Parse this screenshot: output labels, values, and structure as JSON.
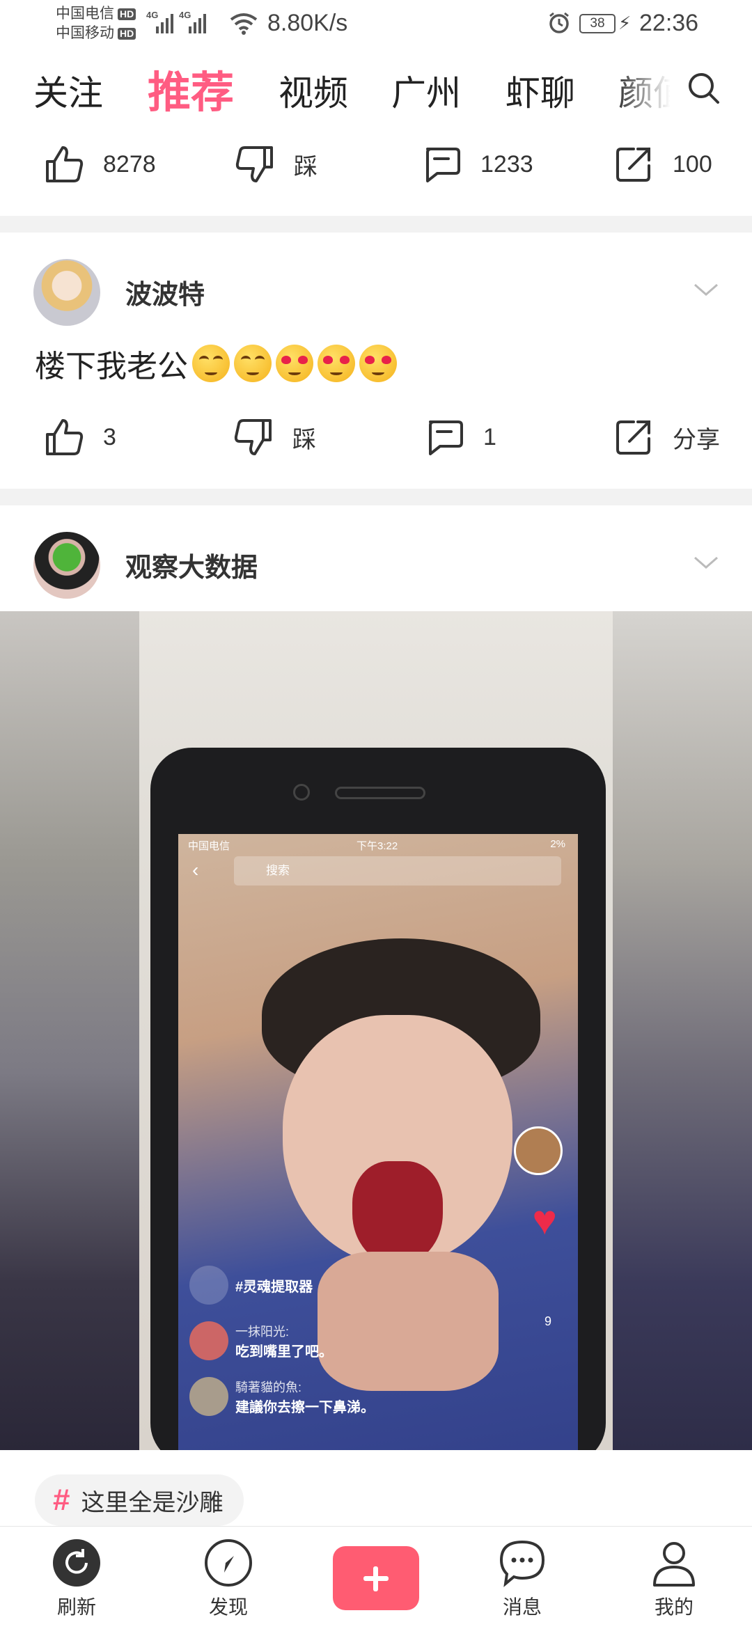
{
  "status_bar": {
    "carrier_1": "中国电信",
    "carrier_2": "中国移动",
    "hd_badge": "HD",
    "network_1": "4G",
    "network_2": "4G",
    "speed": "8.80K/s",
    "battery": "38",
    "time": "22:36"
  },
  "tabs": [
    {
      "label": "关注",
      "active": false
    },
    {
      "label": "推荐",
      "active": true
    },
    {
      "label": "视频",
      "active": false
    },
    {
      "label": "广州",
      "active": false
    },
    {
      "label": "虾聊",
      "active": false
    },
    {
      "label": "颜值",
      "active": false
    }
  ],
  "prev_post": {
    "likes": "8278",
    "dislike_label": "踩",
    "comments": "1233",
    "shares": "100"
  },
  "comment_post": {
    "username": "波波特",
    "text": "楼下我老公",
    "emojis": [
      "smug-face",
      "smug-face",
      "heart-eyes-face",
      "heart-eyes-face",
      "heart-eyes-face"
    ],
    "likes": "3",
    "dislike_label": "踩",
    "comments": "1",
    "share_label": "分享"
  },
  "video_post": {
    "username": "观察大数据",
    "video": {
      "inner_carrier": "中国电信",
      "inner_time": "下午3:22",
      "inner_battery": "2%",
      "inner_search_placeholder": "搜索",
      "comments": [
        {
          "name": "",
          "text": "#灵魂提取器"
        },
        {
          "name": "一抹阳光:",
          "text": "吃到嘴里了吧。"
        },
        {
          "name": "騎著貓的魚:",
          "text": "建議你去擦一下鼻涕。"
        }
      ],
      "side_count": "9"
    },
    "topic": "这里全是沙雕"
  },
  "bottom_nav": {
    "refresh": "刷新",
    "discover": "发现",
    "messages": "消息",
    "me": "我的"
  },
  "colors": {
    "accent": "#ff5c82",
    "publish": "#ff5c72",
    "separator": "#f2f2f2"
  }
}
